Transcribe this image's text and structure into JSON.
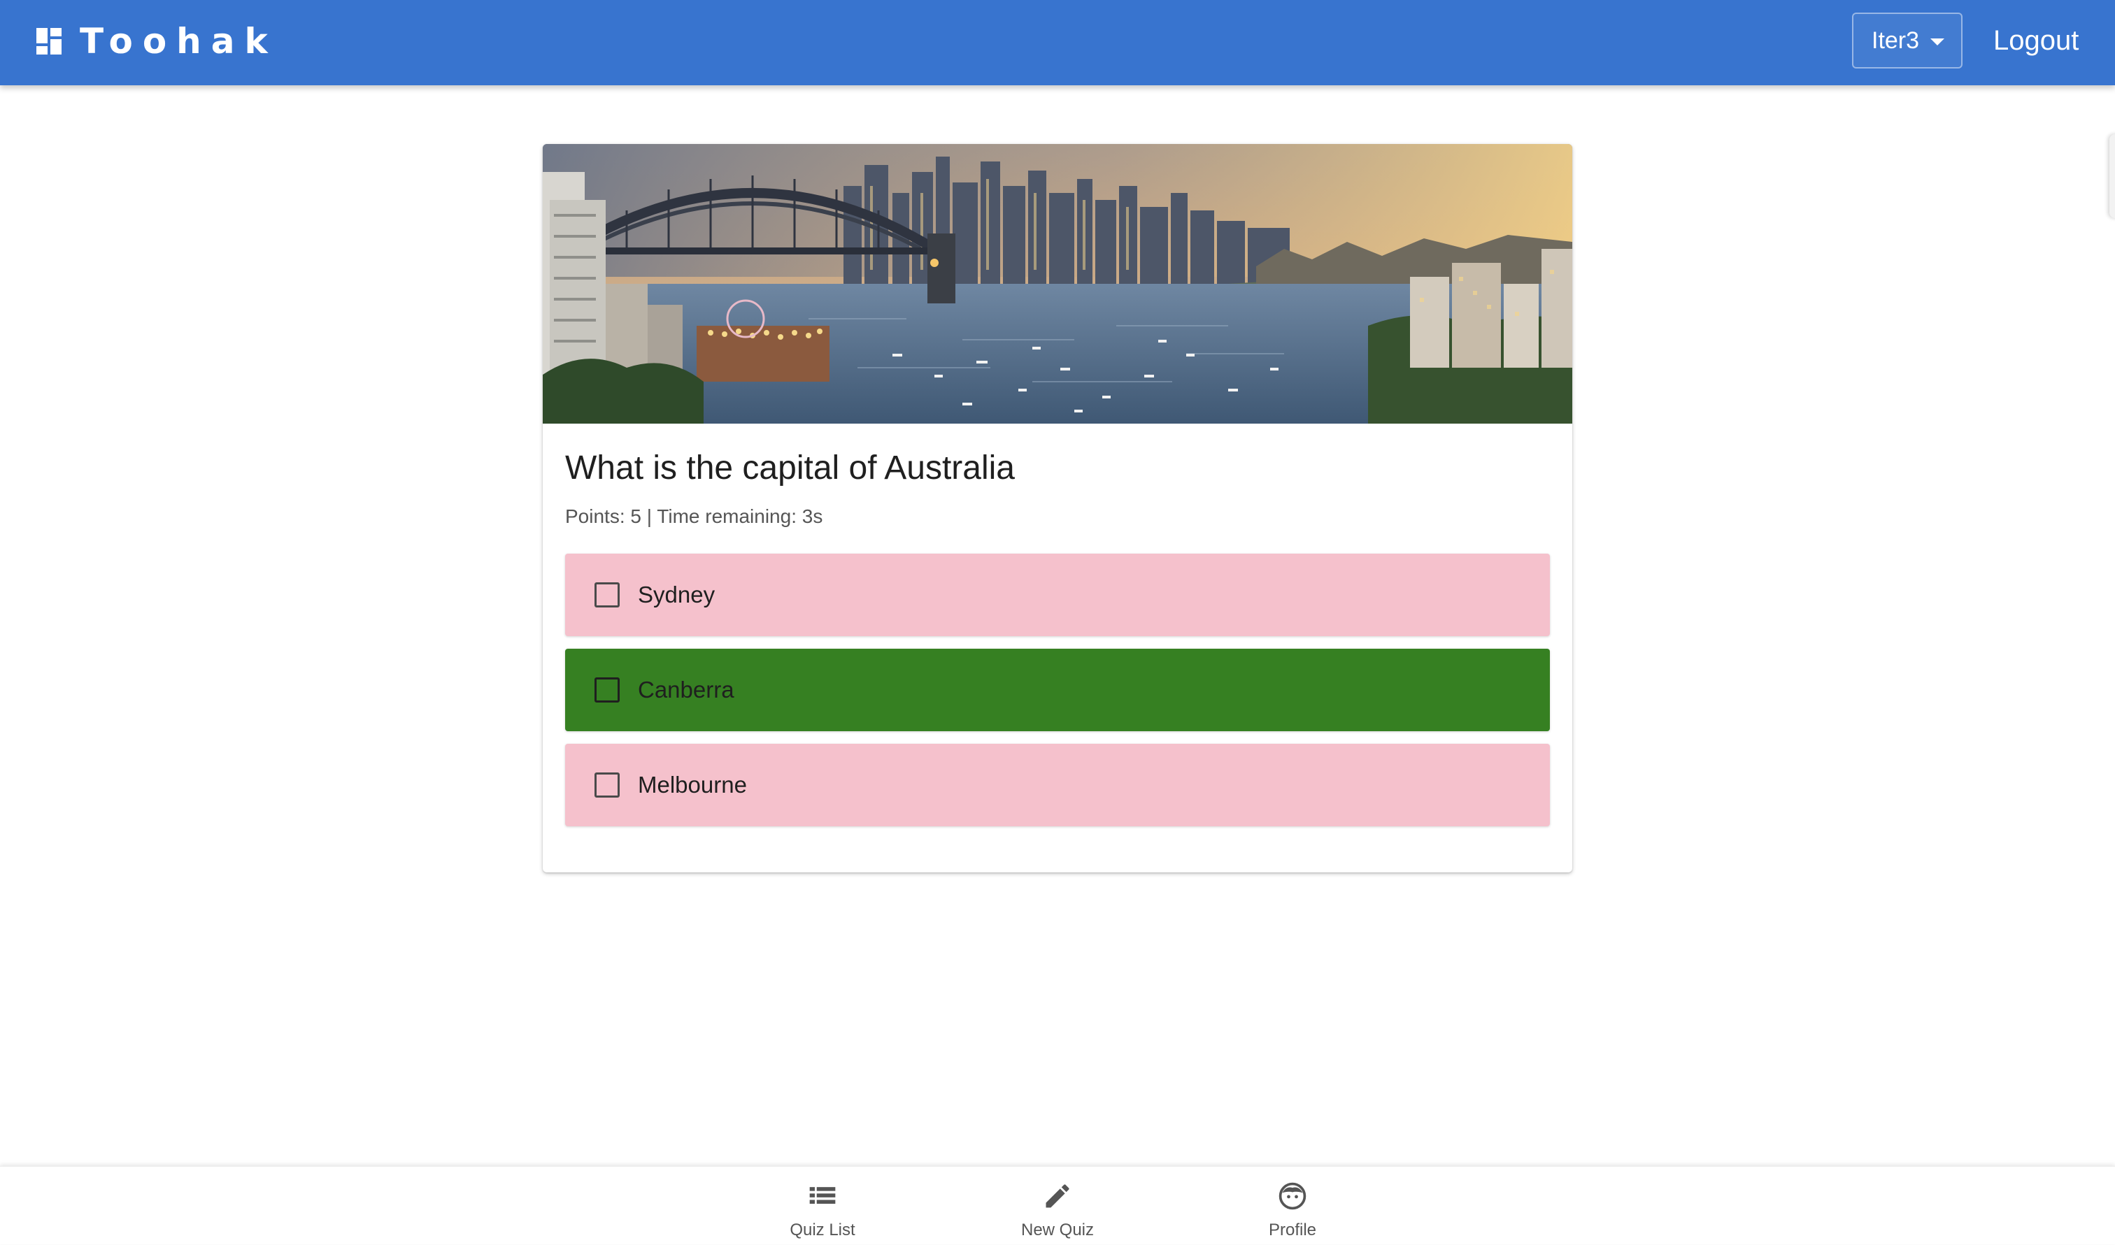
{
  "header": {
    "brand_title": "Toohak",
    "brand_icon": "dashboard-icon",
    "iteration_select": {
      "selected": "Iter3"
    },
    "logout_label": "Logout"
  },
  "question": {
    "image_description": "harbour-city-photo",
    "title": "What is the capital of Australia",
    "meta": "Points: 5 | Time remaining: 3s",
    "answers": [
      {
        "label": "Sydney",
        "status": "incorrect",
        "color": "#f5c1cc"
      },
      {
        "label": "Canberra",
        "status": "correct",
        "color": "#368022"
      },
      {
        "label": "Melbourne",
        "status": "incorrect",
        "color": "#f5c1cc"
      }
    ]
  },
  "bottom_nav": {
    "items": [
      {
        "label": "Quiz List",
        "icon": "list-icon"
      },
      {
        "label": "New Quiz",
        "icon": "pencil-icon"
      },
      {
        "label": "Profile",
        "icon": "face-icon"
      }
    ]
  },
  "colors": {
    "appbar": "#3874cf",
    "correct": "#368022",
    "incorrect": "#f5c1cc"
  }
}
